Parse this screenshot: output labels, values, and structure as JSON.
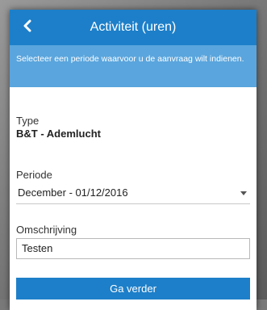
{
  "header": {
    "title": "Activiteit (uren)",
    "back_icon": "chevron-left-icon"
  },
  "info": {
    "text": "Selecteer een periode waarvoor u de aanvraag wilt indienen."
  },
  "form": {
    "type_label": "Type",
    "type_value": "B&T - Ademlucht",
    "periode_label": "Periode",
    "periode_value": "December - 01/12/2016",
    "omschrijving_label": "Omschrijving",
    "omschrijving_value": "Testen"
  },
  "actions": {
    "next_label": "Ga verder"
  },
  "colors": {
    "primary": "#1d7fc9",
    "info_bg": "#5aa5dd"
  }
}
